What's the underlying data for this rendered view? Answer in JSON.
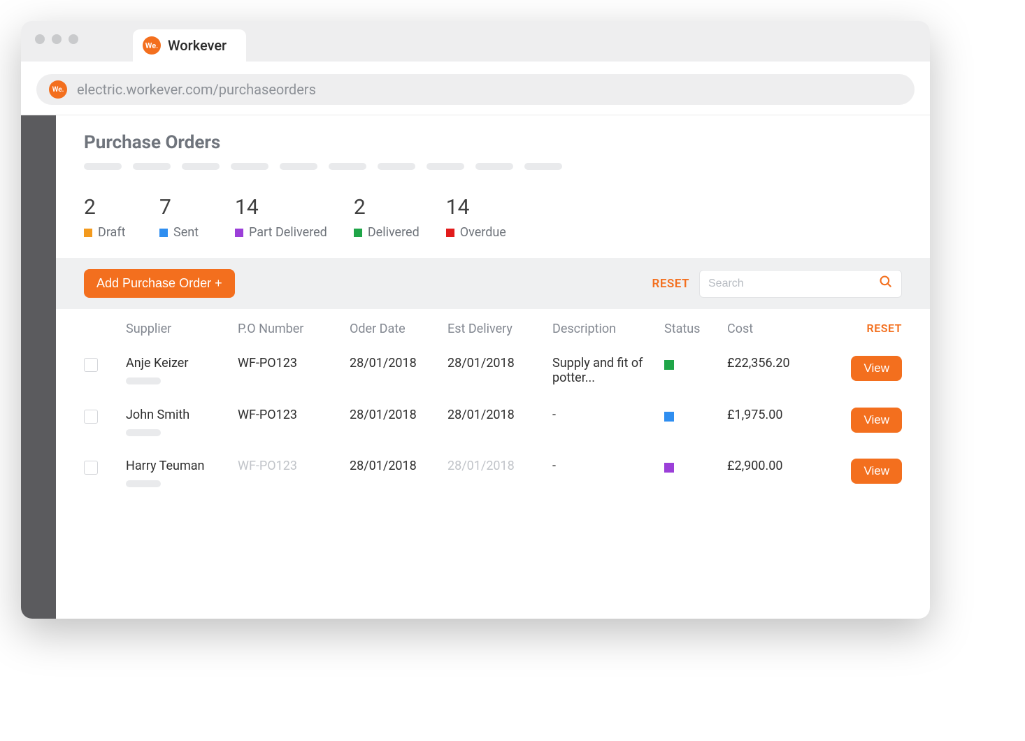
{
  "browser": {
    "tab_title": "Workever",
    "url": "electric.workever.com/purchaseorders",
    "logo_text": "We."
  },
  "page": {
    "title": "Purchase Orders"
  },
  "stats": [
    {
      "count": "2",
      "label": "Draft",
      "color": "#f39a1e"
    },
    {
      "count": "7",
      "label": "Sent",
      "color": "#2f8ef0"
    },
    {
      "count": "14",
      "label": "Part Delivered",
      "color": "#9b3fd8"
    },
    {
      "count": "2",
      "label": "Delivered",
      "color": "#1fa548"
    },
    {
      "count": "14",
      "label": "Overdue",
      "color": "#e21b1b"
    }
  ],
  "toolbar": {
    "add_label": "Add Purchase Order +",
    "reset_label": "RESET",
    "search_placeholder": "Search"
  },
  "table": {
    "headers": {
      "supplier": "Supplier",
      "po_number": "P.O Number",
      "order_date": "Oder Date",
      "est_delivery": "Est Delivery",
      "description": "Description",
      "status": "Status",
      "cost": "Cost",
      "reset": "RESET"
    },
    "rows": [
      {
        "supplier": "Anje Keizer",
        "po_number": "WF-PO123",
        "po_muted": false,
        "order_date": "28/01/2018",
        "est_delivery": "28/01/2018",
        "est_muted": false,
        "description": "Supply and fit of potter...",
        "status_color": "#1fa548",
        "cost": "£22,356.20",
        "view": "View"
      },
      {
        "supplier": "John Smith",
        "po_number": "WF-PO123",
        "po_muted": false,
        "order_date": "28/01/2018",
        "est_delivery": "28/01/2018",
        "est_muted": false,
        "description": "-",
        "status_color": "#2f8ef0",
        "cost": "£1,975.00",
        "view": "View"
      },
      {
        "supplier": "Harry Teuman",
        "po_number": "WF-PO123",
        "po_muted": true,
        "order_date": "28/01/2018",
        "est_delivery": "28/01/2018",
        "est_muted": true,
        "description": "-",
        "status_color": "#9b3fd8",
        "cost": "£2,900.00",
        "view": "View"
      }
    ]
  },
  "colors": {
    "accent": "#f36f1e"
  }
}
